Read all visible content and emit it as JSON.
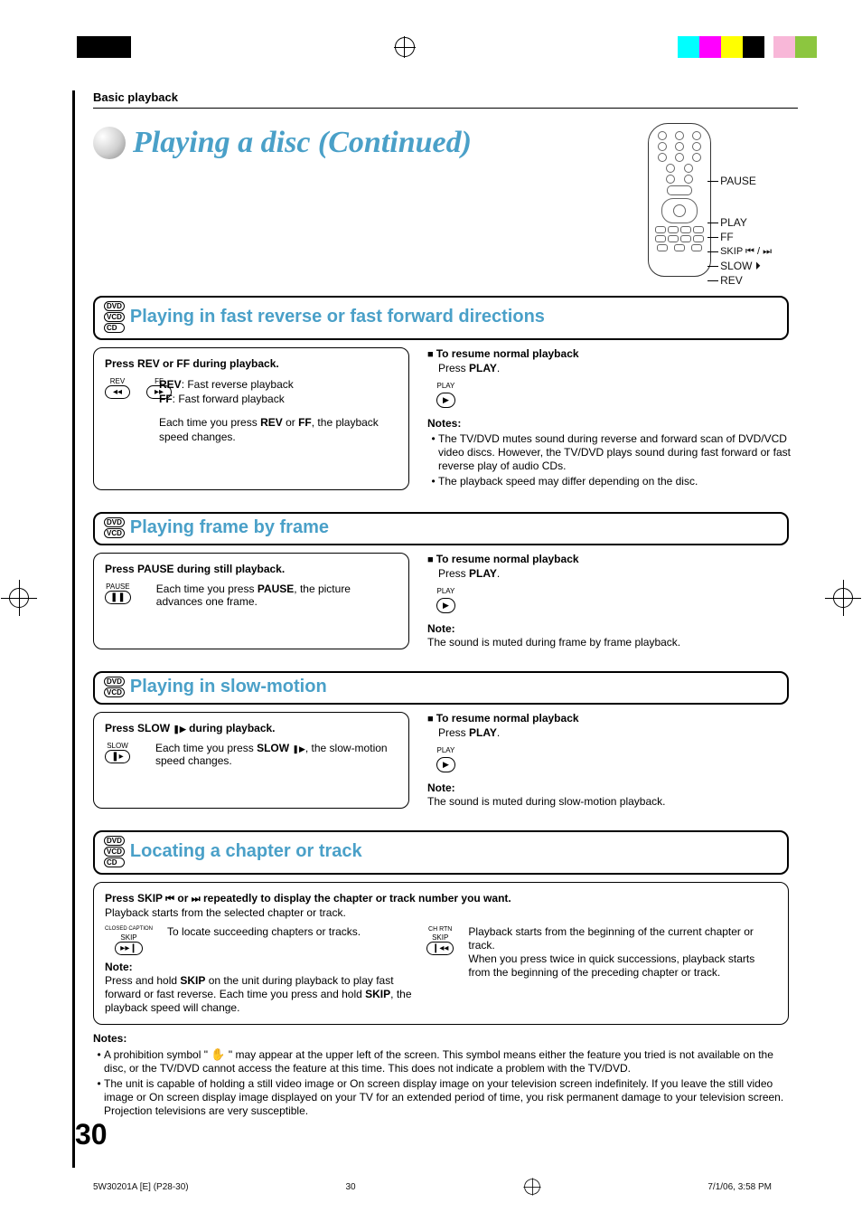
{
  "header": {
    "section": "Basic playback"
  },
  "title": "Playing a disc (Continued)",
  "remote": {
    "labels": [
      "PAUSE",
      "PLAY",
      "FF",
      "SKIP ⏮ / ⏭",
      "SLOW ⏵",
      "REV"
    ]
  },
  "features": [
    {
      "discs": [
        "DVD",
        "VCD",
        "CD"
      ],
      "heading": "Playing in fast reverse or fast forward directions",
      "left": {
        "title": "Press REV or FF during playback.",
        "iconLabels": {
          "rev": "REV",
          "ff": "FF"
        },
        "lines": [
          {
            "label": "REV",
            "text": ":  Fast reverse playback"
          },
          {
            "label": "FF",
            "text": ":    Fast forward playback"
          }
        ],
        "note": "Each time you press REV or FF, the playback speed changes."
      },
      "right": {
        "resume": "To resume normal playback",
        "press": "Press PLAY.",
        "notesHead": "Notes:",
        "notes": [
          "The TV/DVD mutes sound during reverse and forward scan of DVD/VCD video discs. However, the TV/DVD plays sound during fast forward or fast reverse play of audio CDs.",
          "The playback speed may differ depending on the disc."
        ]
      }
    },
    {
      "discs": [
        "DVD",
        "VCD"
      ],
      "heading": "Playing frame by frame",
      "left": {
        "title": "Press PAUSE during still playback.",
        "iconLabels": {
          "pause": "PAUSE"
        },
        "note": "Each time you press PAUSE, the picture advances one frame."
      },
      "right": {
        "resume": "To resume normal playback",
        "press": "Press PLAY.",
        "notesHead": "Note:",
        "notes": [
          "The sound is muted during frame by frame playback."
        ]
      }
    },
    {
      "discs": [
        "DVD",
        "VCD"
      ],
      "heading": "Playing in slow-motion",
      "left": {
        "title": "Press SLOW ⏵ during playback.",
        "iconLabels": {
          "slow": "SLOW"
        },
        "note": "Each time you press SLOW ⏵, the slow-motion speed changes."
      },
      "right": {
        "resume": "To resume normal playback",
        "press": "Press PLAY.",
        "notesHead": "Note:",
        "notes": [
          "The sound is muted during slow-motion playback."
        ]
      }
    },
    {
      "discs": [
        "DVD",
        "VCD",
        "CD"
      ],
      "heading": "Locating a chapter or track",
      "wide": {
        "title": "Press SKIP ⏮ or ⏭ repeatedly to display the chapter or track number you want.",
        "sub": "Playback starts from the selected chapter or track.",
        "col1IconTop": "CLOSED CAPTION",
        "col1IconLabel": "SKIP",
        "col1": "To locate succeeding chapters or tracks.",
        "noteHead": "Note:",
        "note": "Press and hold SKIP on the unit during playback to play fast forward or fast reverse. Each time you press and hold SKIP, the playback speed will change.",
        "col2IconTop": "CH RTN",
        "col2IconLabel": "SKIP",
        "col2a": "Playback starts from the beginning of the current chapter or track.",
        "col2b": "When you press twice in quick successions, playback starts from the beginning of the preceding chapter or track."
      }
    }
  ],
  "bottomNotes": {
    "head": "Notes:",
    "items": [
      "A prohibition symbol \" ✋ \" may appear at the upper left of the screen. This symbol means either the feature you tried is not available on the disc, or the TV/DVD cannot access the feature at this time. This does not indicate a problem with the TV/DVD.",
      "The unit is capable of holding a still video image or On screen display image on your television screen indefinitely. If you leave the still video image or On screen display image displayed on your TV for an extended period of time, you risk permanent damage to your television screen. Projection televisions are very susceptible."
    ]
  },
  "pageNumber": "30",
  "footer": {
    "file": "5W30201A [E] (P28-30)",
    "pg": "30",
    "date": "7/1/06, 3:58 PM"
  },
  "play_label": "PLAY"
}
